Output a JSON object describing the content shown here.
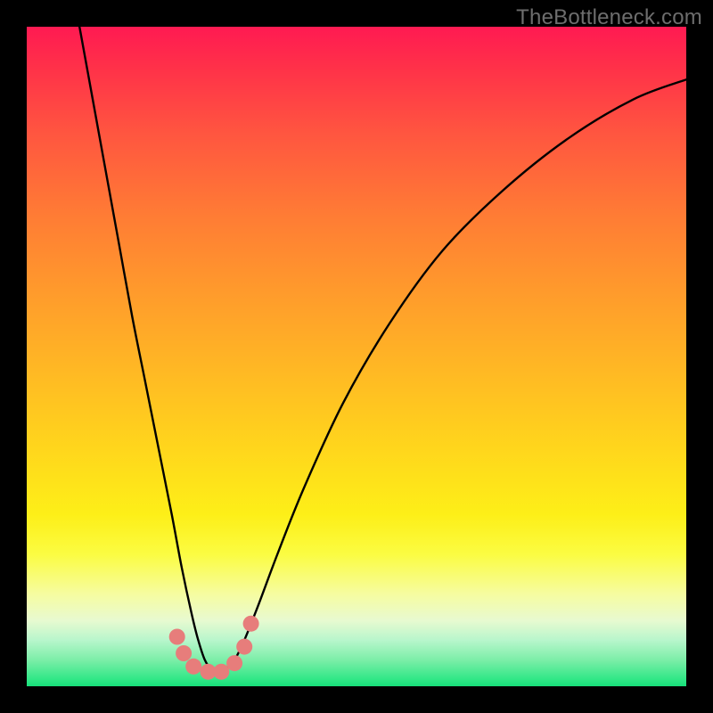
{
  "watermark": "TheBottleneck.com",
  "chart_data": {
    "type": "line",
    "title": "",
    "xlabel": "",
    "ylabel": "",
    "xlim": [
      0,
      100
    ],
    "ylim": [
      0,
      100
    ],
    "series": [
      {
        "name": "curve",
        "x": [
          8,
          10,
          12,
          14,
          16,
          18,
          20,
          22,
          23.5,
          25,
          26,
          27,
          28,
          29,
          30,
          31.5,
          33,
          35,
          38,
          42,
          48,
          55,
          63,
          72,
          82,
          92,
          100
        ],
        "values": [
          100,
          89,
          78,
          67,
          56,
          46,
          36,
          26,
          18,
          11,
          7,
          4,
          2.5,
          2,
          2.5,
          4,
          7,
          12,
          20,
          30,
          43,
          55,
          66,
          75,
          83,
          89,
          92
        ]
      }
    ],
    "markers": {
      "color": "#e77d7b",
      "radius_px": 9,
      "points": [
        {
          "x": 22.8,
          "y": 7.5
        },
        {
          "x": 23.8,
          "y": 5.0
        },
        {
          "x": 25.3,
          "y": 3.0
        },
        {
          "x": 27.5,
          "y": 2.2
        },
        {
          "x": 29.5,
          "y": 2.2
        },
        {
          "x": 31.5,
          "y": 3.5
        },
        {
          "x": 33.0,
          "y": 6.0
        },
        {
          "x": 34.0,
          "y": 9.5
        }
      ]
    },
    "gradient_stops": [
      {
        "pct": 0,
        "color": "#ff1a52"
      },
      {
        "pct": 50,
        "color": "#ffb824"
      },
      {
        "pct": 80,
        "color": "#fbfc42"
      },
      {
        "pct": 100,
        "color": "#17e07a"
      }
    ]
  }
}
